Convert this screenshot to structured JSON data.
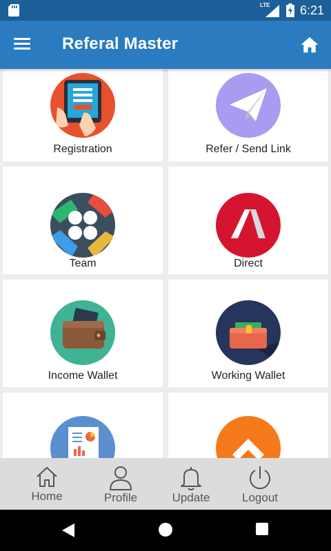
{
  "status_bar": {
    "time": "6:21",
    "network": "LTE",
    "battery_icon": "battery-charging-icon",
    "sd_icon": "sd-card-icon"
  },
  "app_bar": {
    "title": "Referal Master",
    "menu_icon": "hamburger-menu-icon",
    "home_icon": "home-icon",
    "color": "#2b7bc0"
  },
  "tiles": [
    {
      "label": "Registration",
      "icon": "registration-tablet-icon"
    },
    {
      "label": "Refer / Send Link",
      "icon": "paper-plane-icon"
    },
    {
      "label": "Team",
      "icon": "team-hands-icon"
    },
    {
      "label": "Direct",
      "icon": "direct-logo-icon"
    },
    {
      "label": "Income Wallet",
      "icon": "wallet-card-icon"
    },
    {
      "label": "Working Wallet",
      "icon": "wallet-cash-icon"
    },
    {
      "label": "",
      "icon": "report-chart-icon"
    },
    {
      "label": "",
      "icon": "chevron-up-icon"
    }
  ],
  "bottom_nav": {
    "items": [
      {
        "label": "Home",
        "icon": "home-outline-icon"
      },
      {
        "label": "Profile",
        "icon": "person-outline-icon"
      },
      {
        "label": "Update",
        "icon": "bell-outline-icon"
      },
      {
        "label": "Logout",
        "icon": "power-icon"
      }
    ]
  }
}
